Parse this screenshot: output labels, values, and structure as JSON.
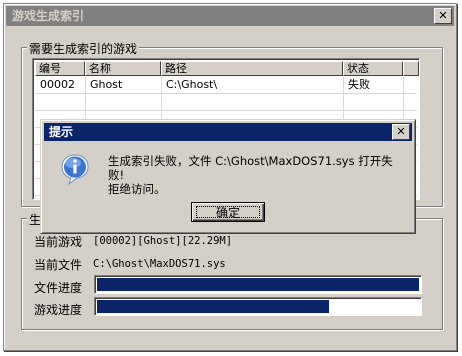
{
  "window": {
    "title": "游戏生成索引",
    "close_glyph": "✕"
  },
  "games_group": {
    "label": "需要生成索引的游戏",
    "columns": [
      "编号",
      "名称",
      "路径",
      "状态"
    ],
    "rows": [
      {
        "id": "00002",
        "name": "Ghost",
        "path": "C:\\Ghost\\",
        "status": "失败"
      }
    ]
  },
  "progress_group": {
    "label": "生成",
    "current_game_label": "当前游戏",
    "current_game_value": "[00002][Ghost][22.29M]",
    "current_file_label": "当前文件",
    "current_file_value": "C:\\Ghost\\MaxDOS71.sys",
    "file_progress_label": "文件进度",
    "file_progress": 1.0,
    "game_progress_label": "游戏进度",
    "game_progress": 0.72
  },
  "dialog": {
    "title": "提示",
    "close_glyph": "✕",
    "icon": "info-icon",
    "message_line1": "生成索引失败，文件 C:\\Ghost\\MaxDOS71.sys 打开失败!",
    "message_line2": "拒绝访问。",
    "ok_label": "确定"
  },
  "colors": {
    "face": "#d4d0c8",
    "active_title": "#0a246a",
    "inactive_title": "#808080",
    "progress_fill": "#0a246a"
  }
}
